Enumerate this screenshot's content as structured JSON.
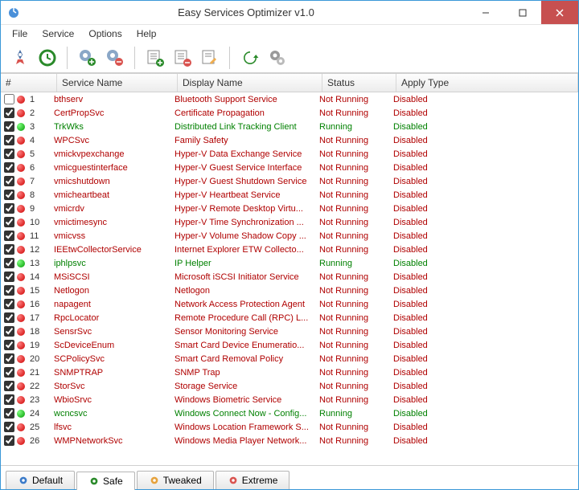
{
  "window": {
    "title": "Easy Services Optimizer v1.0"
  },
  "menu": {
    "file": "File",
    "service": "Service",
    "options": "Options",
    "help": "Help"
  },
  "columns": {
    "num": "#",
    "svc": "Service Name",
    "disp": "Display Name",
    "stat": "Status",
    "apply": "Apply Type"
  },
  "tabs": {
    "default": "Default",
    "safe": "Safe",
    "tweaked": "Tweaked",
    "extreme": "Extreme"
  },
  "rows": [
    {
      "n": 1,
      "chk": false,
      "dot": "red",
      "svc": "bthserv",
      "disp": "Bluetooth Support Service",
      "stat": "Not Running",
      "apply": "Disabled",
      "run": false
    },
    {
      "n": 2,
      "chk": true,
      "dot": "red",
      "svc": "CertPropSvc",
      "disp": "Certificate Propagation",
      "stat": "Not Running",
      "apply": "Disabled",
      "run": false
    },
    {
      "n": 3,
      "chk": true,
      "dot": "green",
      "svc": "TrkWks",
      "disp": "Distributed Link Tracking Client",
      "stat": "Running",
      "apply": "Disabled",
      "run": true
    },
    {
      "n": 4,
      "chk": true,
      "dot": "red",
      "svc": "WPCSvc",
      "disp": "Family Safety",
      "stat": "Not Running",
      "apply": "Disabled",
      "run": false
    },
    {
      "n": 5,
      "chk": true,
      "dot": "red",
      "svc": "vmickvpexchange",
      "disp": "Hyper-V Data Exchange Service",
      "stat": "Not Running",
      "apply": "Disabled",
      "run": false
    },
    {
      "n": 6,
      "chk": true,
      "dot": "red",
      "svc": "vmicguestinterface",
      "disp": "Hyper-V Guest Service Interface",
      "stat": "Not Running",
      "apply": "Disabled",
      "run": false
    },
    {
      "n": 7,
      "chk": true,
      "dot": "red",
      "svc": "vmicshutdown",
      "disp": "Hyper-V Guest Shutdown Service",
      "stat": "Not Running",
      "apply": "Disabled",
      "run": false
    },
    {
      "n": 8,
      "chk": true,
      "dot": "red",
      "svc": "vmicheartbeat",
      "disp": "Hyper-V Heartbeat Service",
      "stat": "Not Running",
      "apply": "Disabled",
      "run": false
    },
    {
      "n": 9,
      "chk": true,
      "dot": "red",
      "svc": "vmicrdv",
      "disp": "Hyper-V Remote Desktop Virtu...",
      "stat": "Not Running",
      "apply": "Disabled",
      "run": false
    },
    {
      "n": 10,
      "chk": true,
      "dot": "red",
      "svc": "vmictimesync",
      "disp": "Hyper-V Time Synchronization ...",
      "stat": "Not Running",
      "apply": "Disabled",
      "run": false
    },
    {
      "n": 11,
      "chk": true,
      "dot": "red",
      "svc": "vmicvss",
      "disp": "Hyper-V Volume Shadow Copy ...",
      "stat": "Not Running",
      "apply": "Disabled",
      "run": false
    },
    {
      "n": 12,
      "chk": true,
      "dot": "red",
      "svc": "IEEtwCollectorService",
      "disp": "Internet Explorer ETW Collecto...",
      "stat": "Not Running",
      "apply": "Disabled",
      "run": false
    },
    {
      "n": 13,
      "chk": true,
      "dot": "green",
      "svc": "iphlpsvc",
      "disp": "IP Helper",
      "stat": "Running",
      "apply": "Disabled",
      "run": true
    },
    {
      "n": 14,
      "chk": true,
      "dot": "red",
      "svc": "MSiSCSI",
      "disp": "Microsoft iSCSI Initiator Service",
      "stat": "Not Running",
      "apply": "Disabled",
      "run": false
    },
    {
      "n": 15,
      "chk": true,
      "dot": "red",
      "svc": "Netlogon",
      "disp": "Netlogon",
      "stat": "Not Running",
      "apply": "Disabled",
      "run": false
    },
    {
      "n": 16,
      "chk": true,
      "dot": "red",
      "svc": "napagent",
      "disp": "Network Access Protection Agent",
      "stat": "Not Running",
      "apply": "Disabled",
      "run": false
    },
    {
      "n": 17,
      "chk": true,
      "dot": "red",
      "svc": "RpcLocator",
      "disp": "Remote Procedure Call (RPC) L...",
      "stat": "Not Running",
      "apply": "Disabled",
      "run": false
    },
    {
      "n": 18,
      "chk": true,
      "dot": "red",
      "svc": "SensrSvc",
      "disp": "Sensor Monitoring Service",
      "stat": "Not Running",
      "apply": "Disabled",
      "run": false
    },
    {
      "n": 19,
      "chk": true,
      "dot": "red",
      "svc": "ScDeviceEnum",
      "disp": "Smart Card Device Enumeratio...",
      "stat": "Not Running",
      "apply": "Disabled",
      "run": false
    },
    {
      "n": 20,
      "chk": true,
      "dot": "red",
      "svc": "SCPolicySvc",
      "disp": "Smart Card Removal Policy",
      "stat": "Not Running",
      "apply": "Disabled",
      "run": false
    },
    {
      "n": 21,
      "chk": true,
      "dot": "red",
      "svc": "SNMPTRAP",
      "disp": "SNMP Trap",
      "stat": "Not Running",
      "apply": "Disabled",
      "run": false
    },
    {
      "n": 22,
      "chk": true,
      "dot": "red",
      "svc": "StorSvc",
      "disp": "Storage Service",
      "stat": "Not Running",
      "apply": "Disabled",
      "run": false
    },
    {
      "n": 23,
      "chk": true,
      "dot": "red",
      "svc": "WbioSrvc",
      "disp": "Windows Biometric Service",
      "stat": "Not Running",
      "apply": "Disabled",
      "run": false
    },
    {
      "n": 24,
      "chk": true,
      "dot": "green",
      "svc": "wcncsvc",
      "disp": "Windows Connect Now - Config...",
      "stat": "Running",
      "apply": "Disabled",
      "run": true
    },
    {
      "n": 25,
      "chk": true,
      "dot": "red",
      "svc": "lfsvc",
      "disp": "Windows Location Framework S...",
      "stat": "Not Running",
      "apply": "Disabled",
      "run": false
    },
    {
      "n": 26,
      "chk": true,
      "dot": "red",
      "svc": "WMPNetworkSvc",
      "disp": "Windows Media Player Network...",
      "stat": "Not Running",
      "apply": "Disabled",
      "run": false
    }
  ]
}
